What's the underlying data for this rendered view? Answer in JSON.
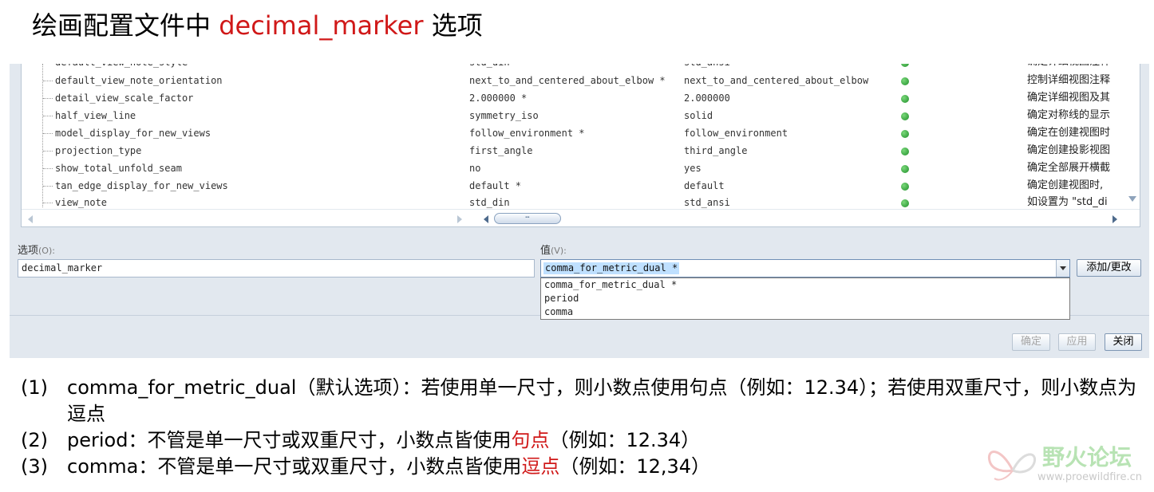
{
  "title": {
    "prefix": "绘画配置文件中 ",
    "highlight": "decimal_marker",
    "suffix": " 选项"
  },
  "table": {
    "cut_row": [
      "default_view_note_style",
      "std_din",
      "std_ansi",
      "确定详细视图注释"
    ],
    "rows": [
      {
        "name": "default_view_note_orientation",
        "value": "next_to_and_centered_about_elbow *",
        "default": "next_to_and_centered_about_elbow",
        "description": "控制详细视图注释"
      },
      {
        "name": "detail_view_scale_factor",
        "value": "2.000000 *",
        "default": "2.000000",
        "description": "确定详细视图及其"
      },
      {
        "name": "half_view_line",
        "value": "symmetry_iso",
        "default": "solid",
        "description": "确定对称线的显示"
      },
      {
        "name": "model_display_for_new_views",
        "value": "follow_environment *",
        "default": "follow_environment",
        "description": "确定在创建视图时"
      },
      {
        "name": "projection_type",
        "value": "first_angle",
        "default": "third_angle",
        "description": "确定创建投影视图"
      },
      {
        "name": "show_total_unfold_seam",
        "value": "no",
        "default": "yes",
        "description": "确定全部展开横截"
      },
      {
        "name": "tan_edge_display_for_new_views",
        "value": "default *",
        "default": "default",
        "description": "确定创建视图时,"
      },
      {
        "name": "view_note",
        "value": "std_din",
        "default": "std_ansi",
        "description": "如设置为 \"std_di"
      }
    ],
    "status_color": "#2a9a35",
    "hscroll_thumb": "⋯"
  },
  "form": {
    "option_label": "选项",
    "option_hint": "(O):",
    "option_value": "decimal_marker",
    "value_label": "值",
    "value_hint": "(V):",
    "value_selected": "comma_for_metric_dual *",
    "dropdown_options": [
      "comma_for_metric_dual *",
      "period",
      "comma"
    ],
    "add_change_button": "添加/更改"
  },
  "footer": {
    "ok_button": "确定",
    "apply_button": "应用",
    "close_button": "关闭"
  },
  "notes": [
    {
      "num": "(1)",
      "pre": "comma_for_metric_dual（默认选项）：若使用单一尺寸，则小数点使用句点（例如：12.34）；若使用双重尺寸，则小数点为逗点",
      "red": "",
      "post": ""
    },
    {
      "num": "(2)",
      "pre": "period：不管是单一尺寸或双重尺寸，小数点皆使用",
      "red": "句点",
      "post": "（例如：12.34）"
    },
    {
      "num": "(3)",
      "pre": "comma：不管是单一尺寸或双重尺寸，小数点皆使用",
      "red": "逗点",
      "post": "（例如：12,34）"
    }
  ],
  "watermark": {
    "name": "野火论坛",
    "url": "www.proewildfire.cn"
  }
}
